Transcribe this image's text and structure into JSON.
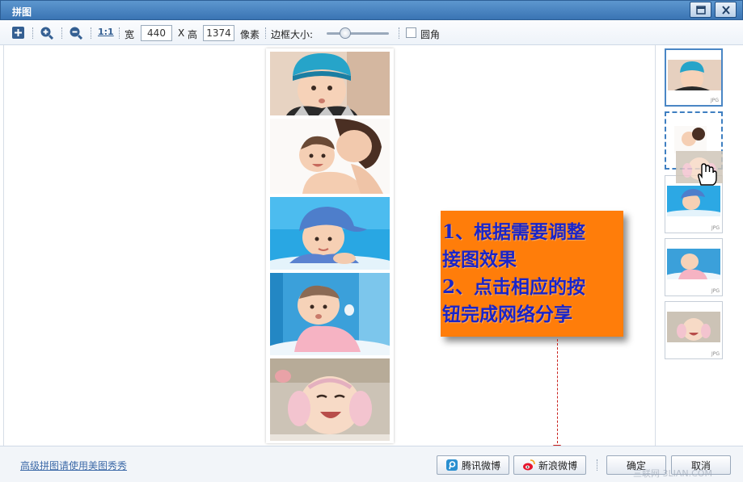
{
  "window": {
    "title": "拼图"
  },
  "toolbar": {
    "one_to_one": "1:1",
    "width_label": "宽",
    "width_value": "440",
    "x_label": "X",
    "height_label": "高",
    "height_value": "1374",
    "pixel_label": "像素",
    "border_label": "边框大小:",
    "border_level": 0.3,
    "rounded_label": "圆角",
    "rounded_checked": false
  },
  "thumbnails": {
    "tag": "JPG"
  },
  "callout": {
    "line1": "1、根据需要调整",
    "line2": "接图效果",
    "line3": "2、点击相应的按",
    "line4": "钮完成网络分享"
  },
  "footer": {
    "link": "高级拼图请使用美图秀秀",
    "tencent": "腾讯微博",
    "sina": "新浪微博",
    "ok": "确定",
    "cancel": "取消",
    "watermark": "三联网 3LIAN.COM"
  },
  "colors": {
    "accent": "#4a86c5",
    "callout_bg": "#ff7d0a",
    "callout_text": "#1a25c8",
    "arrow": "#c8201c"
  }
}
